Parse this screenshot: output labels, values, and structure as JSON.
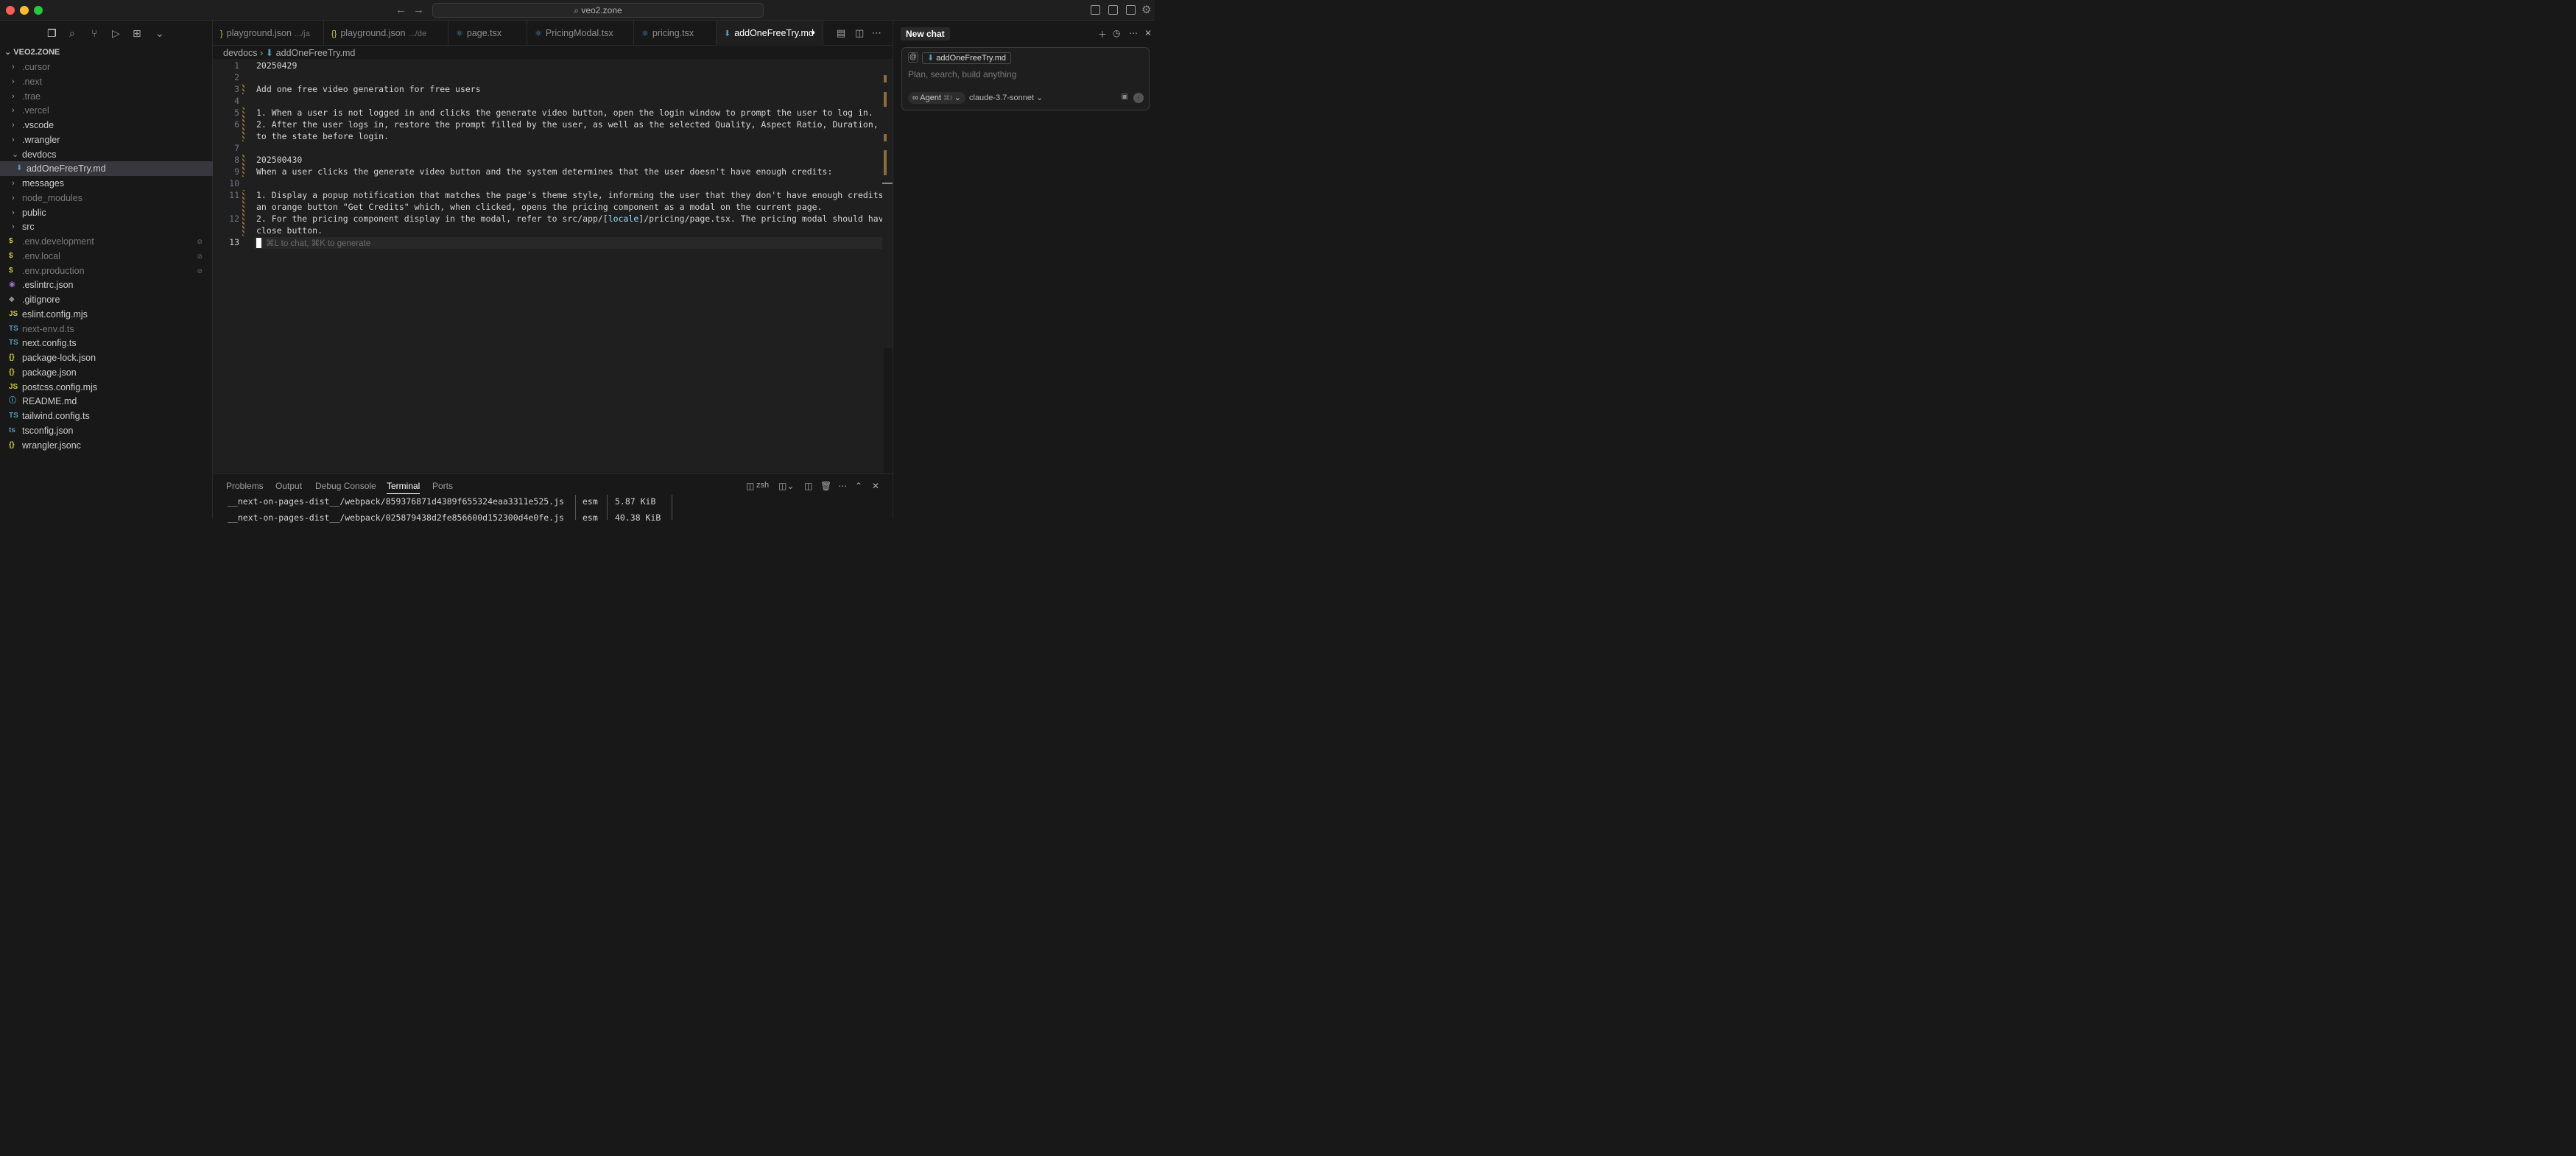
{
  "titlebar": {
    "search": "veo2.zone",
    "back": "←",
    "forward": "→"
  },
  "sidebar": {
    "section_title": "VEO2.ZONE",
    "items": [
      {
        "label": ".cursor",
        "kind": "folder",
        "dim": true
      },
      {
        "label": ".next",
        "kind": "folder",
        "dim": true
      },
      {
        "label": ".trae",
        "kind": "folder",
        "dim": true
      },
      {
        "label": ".vercel",
        "kind": "folder",
        "dim": true
      },
      {
        "label": ".vscode",
        "kind": "folder",
        "dim": false
      },
      {
        "label": ".wrangler",
        "kind": "folder",
        "dim": false
      },
      {
        "label": "devdocs",
        "kind": "folder-open",
        "dim": false
      },
      {
        "label": "addOneFreeTry.md",
        "kind": "md",
        "dim": false,
        "selected": true
      },
      {
        "label": "messages",
        "kind": "folder",
        "dim": false
      },
      {
        "label": "node_modules",
        "kind": "folder",
        "dim": true
      },
      {
        "label": "public",
        "kind": "folder",
        "dim": false
      },
      {
        "label": "src",
        "kind": "folder",
        "dim": false
      },
      {
        "label": ".env.development",
        "kind": "env",
        "dim": true
      },
      {
        "label": ".env.local",
        "kind": "env",
        "dim": true
      },
      {
        "label": ".env.production",
        "kind": "env",
        "dim": true
      },
      {
        "label": ".eslintrc.json",
        "kind": "eslint",
        "dim": false
      },
      {
        "label": ".gitignore",
        "kind": "git",
        "dim": false
      },
      {
        "label": "eslint.config.mjs",
        "kind": "js",
        "dim": false
      },
      {
        "label": "next-env.d.ts",
        "kind": "ts",
        "dim": true
      },
      {
        "label": "next.config.ts",
        "kind": "ts",
        "dim": false
      },
      {
        "label": "package-lock.json",
        "kind": "json",
        "dim": false
      },
      {
        "label": "package.json",
        "kind": "json",
        "dim": false
      },
      {
        "label": "postcss.config.mjs",
        "kind": "js",
        "dim": false
      },
      {
        "label": "README.md",
        "kind": "info",
        "dim": false
      },
      {
        "label": "tailwind.config.ts",
        "kind": "ts",
        "dim": false
      },
      {
        "label": "tsconfig.json",
        "kind": "tsconfig",
        "dim": false
      },
      {
        "label": "wrangler.jsonc",
        "kind": "json",
        "dim": false
      }
    ]
  },
  "tabs": [
    {
      "label": "playground.json",
      "hint": ".../ja",
      "icon": "}"
    },
    {
      "label": "playground.json",
      "hint": ".../de",
      "icon": "{}"
    },
    {
      "label": "page.tsx",
      "hint": "",
      "icon": "⚛"
    },
    {
      "label": "PricingModal.tsx",
      "hint": "",
      "icon": "⚛"
    },
    {
      "label": "pricing.tsx",
      "hint": "",
      "icon": "⚛"
    },
    {
      "label": "addOneFreeTry.md",
      "hint": "",
      "icon": "⬇",
      "active": true,
      "modified": "●"
    }
  ],
  "breadcrumb": {
    "folder": "devdocs",
    "sep": "›",
    "file": "addOneFreeTry.md"
  },
  "editor": {
    "line_numbers": [
      "1",
      "2",
      "3",
      "4",
      "5",
      "6",
      "7",
      "8",
      "9",
      "10",
      "11",
      "12",
      "13"
    ],
    "lines": [
      "20250429",
      "",
      "Add one free video generation for free users",
      "",
      "1. When a user is not logged in and clicks the generate video button, open the login window to prompt the user to log in.",
      "2. After the user logs in, restore the prompt filled by the user, as well as the selected Quality, Aspect Ratio, Duration, etc.",
      "to the state before login.",
      "",
      "202500430",
      "When a user clicks the generate video button and the system determines that the user doesn't have enough credits:",
      "",
      "1. Display a popup notification that matches the page's theme style, informing the user that they don't have enough credits. Show",
      "an orange button \"Get Credits\" which, when clicked, opens the pricing component as a modal on the current page.",
      "2. For the pricing component display in the modal, refer to src/app/[",
      "locale",
      "]/pricing/page.tsx. The pricing modal should have a",
      "close button."
    ],
    "ghost_hint": "⌘L to chat, ⌘K to generate"
  },
  "panel": {
    "tabs": [
      "Problems",
      "Output",
      "Debug Console",
      "Terminal",
      "Ports"
    ],
    "active_tab": "Terminal",
    "shell": "zsh",
    "rows": [
      {
        "file": "__next-on-pages-dist__/webpack/859376871d4389f655324eaa3311e525.js",
        "format": "esm",
        "size": "5.87 KiB"
      },
      {
        "file": "__next-on-pages-dist__/webpack/025879438d2fe856600d152300d4e0fe.js",
        "format": "esm",
        "size": "40.38 KiB"
      }
    ]
  },
  "chat": {
    "tab": "New chat",
    "at": "@",
    "file_chip": "addOneFreeTry.md",
    "placeholder": "Plan, search, build anything",
    "agent": "Agent",
    "agent_kbd": "⌘I",
    "model": "claude-3.7-sonnet"
  }
}
